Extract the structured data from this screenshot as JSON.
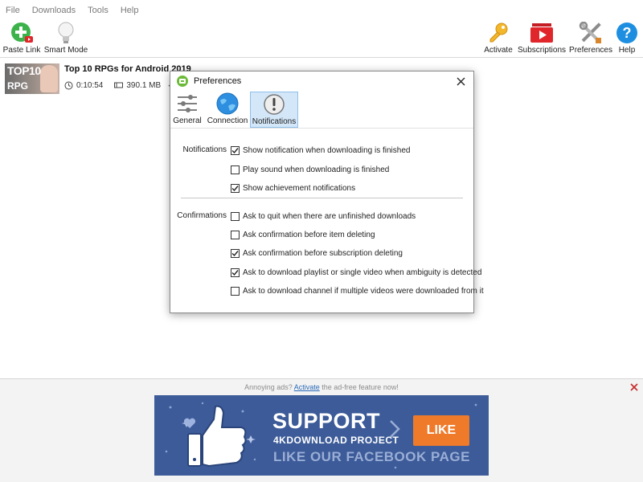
{
  "menu": {
    "items": [
      "File",
      "Downloads",
      "Tools",
      "Help"
    ]
  },
  "toolbar": {
    "paste_link": "Paste Link",
    "smart_mode": "Smart Mode",
    "activate": "Activate",
    "subscriptions": "Subscriptions",
    "preferences": "Preferences",
    "help": "Help"
  },
  "download": {
    "thumb_line1": "TOP10",
    "thumb_line2": "RPG",
    "title": "Top 10 RPGs for Android 2019",
    "duration": "0:10:54",
    "size": "390.1 MB"
  },
  "dialog": {
    "title": "Preferences",
    "tabs": [
      {
        "label": "General",
        "icon": "sliders-icon"
      },
      {
        "label": "Connection",
        "icon": "globe-icon"
      },
      {
        "label": "Notifications",
        "icon": "exclamation-icon"
      }
    ],
    "active_tab": "Notifications",
    "notifications": {
      "label": "Notifications",
      "options": [
        {
          "label": "Show notification when downloading is finished",
          "checked": true
        },
        {
          "label": "Play sound when downloading is finished",
          "checked": false
        },
        {
          "label": "Show achievement notifications",
          "checked": true
        }
      ]
    },
    "confirmations": {
      "label": "Confirmations",
      "options": [
        {
          "label": "Ask to quit when there are unfinished downloads",
          "checked": false
        },
        {
          "label": "Ask confirmation before item deleting",
          "checked": false
        },
        {
          "label": "Ask confirmation before subscription deleting",
          "checked": true
        },
        {
          "label": "Ask to download playlist or single video when ambiguity is detected",
          "checked": true
        },
        {
          "label": "Ask to download channel if multiple videos were downloaded from it",
          "checked": false
        }
      ]
    }
  },
  "ad": {
    "prefix": "Annoying ads?",
    "link": "Activate",
    "suffix": "the ad-free feature now!",
    "banner": {
      "support": "SUPPORT",
      "project": "4KDOWNLOAD PROJECT",
      "like": "LIKE",
      "facebook": "LIKE OUR FACEBOOK PAGE"
    }
  },
  "colors": {
    "accent_blue": "#2a6ab8",
    "banner_bg": "#3c5b98",
    "banner_like": "#ef7a2a",
    "tab_active": "#d3e7f9",
    "paste_green": "#3cb24a"
  }
}
